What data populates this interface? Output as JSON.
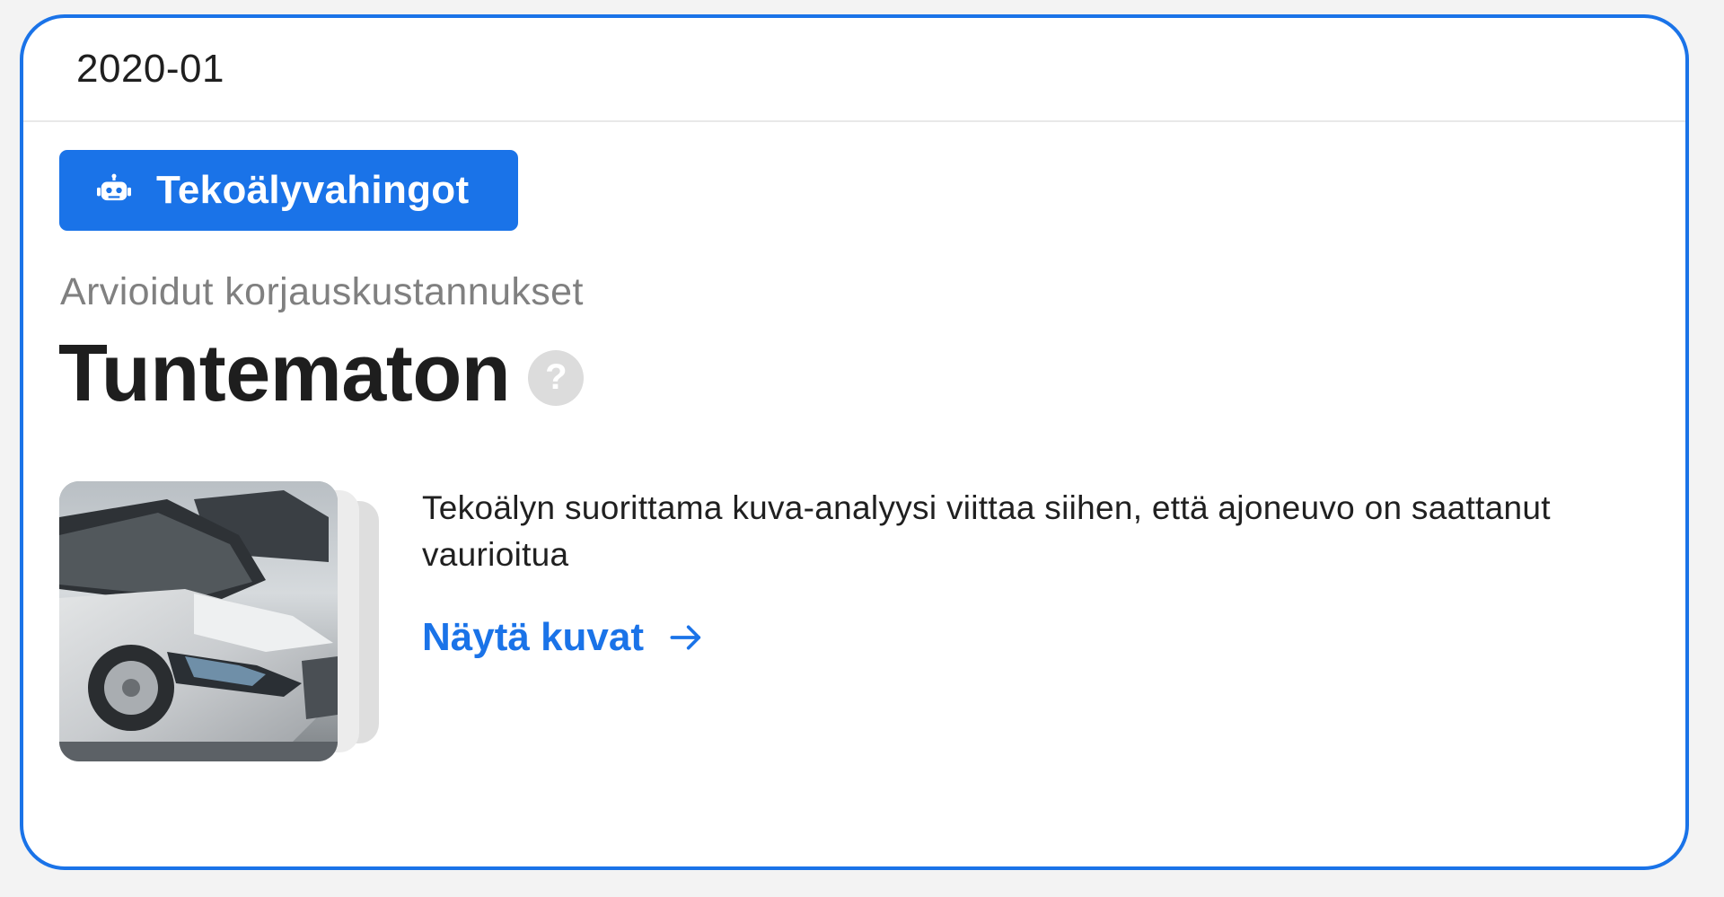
{
  "card": {
    "date": "2020-01",
    "ai_badge": {
      "icon": "robot-icon",
      "label": "Tekoälyvahingot"
    },
    "estimate_label": "Arvioidut korjauskustannukset",
    "estimate_value": "Tuntematon",
    "help_icon": "question-mark-icon",
    "photo": {
      "icon": "car-damage-photo"
    },
    "description": "Tekoälyn suorittama kuva-analyysi viittaa siihen, että ajoneuvo on saattanut vaurioitua",
    "link": {
      "label": "Näytä kuvat",
      "icon": "arrow-right-icon"
    }
  },
  "colors": {
    "accent": "#1a73e8",
    "muted_text": "#808080",
    "help_icon_bg": "#dcdcdc"
  }
}
